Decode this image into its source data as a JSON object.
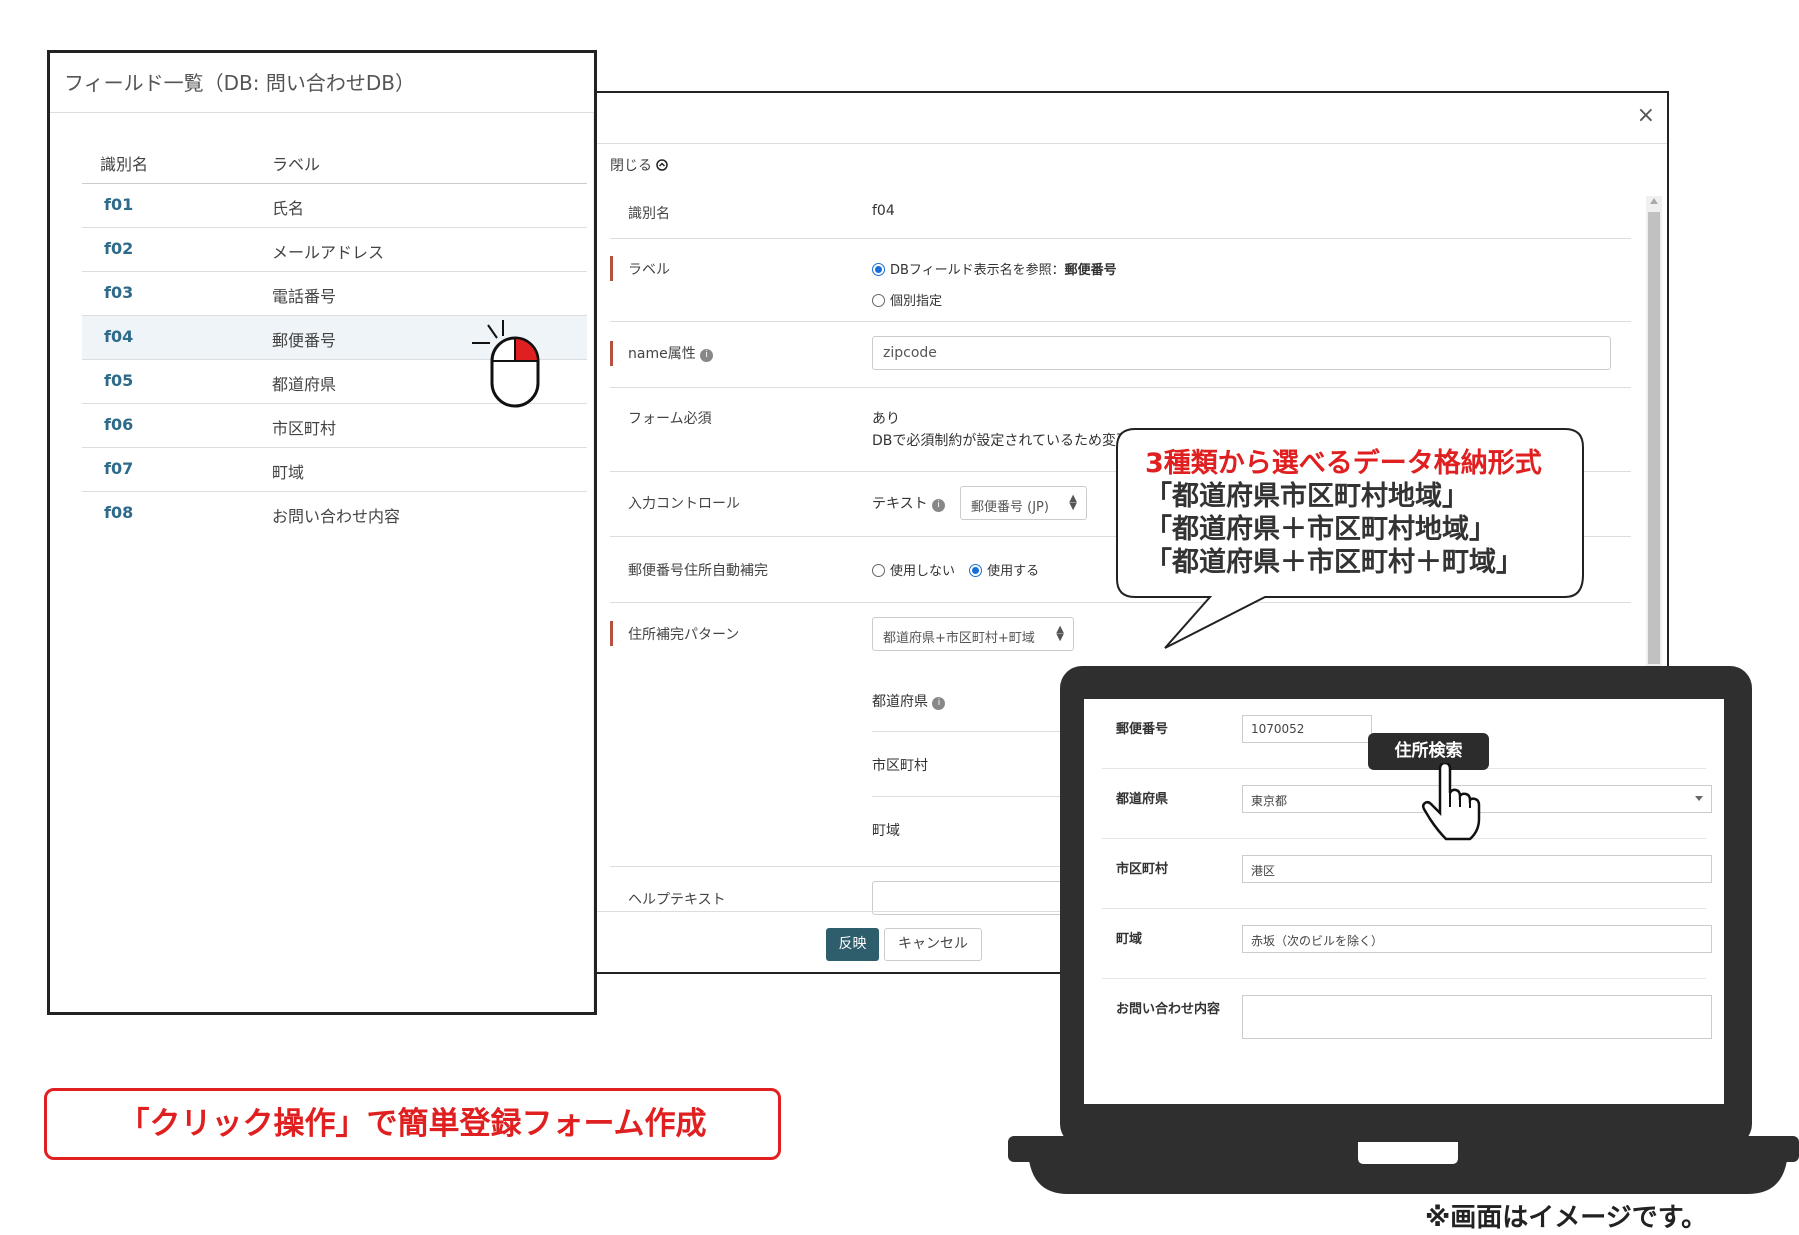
{
  "modal": {
    "close_icon": "×",
    "collapse_label": "閉じる",
    "fields": {
      "identifier": {
        "label": "識別名",
        "value": "f04"
      },
      "label": {
        "label": "ラベル",
        "option_ref": "DBフィールド表示名を参照：",
        "option_ref_value": "郵便番号",
        "option_custom": "個別指定"
      },
      "name_attr": {
        "label": "name属性",
        "value": "zipcode"
      },
      "required": {
        "label": "フォーム必須",
        "value": "あり",
        "note": "DBで必須制約が設定されているため変更"
      },
      "input_control": {
        "label": "入力コントロール",
        "type": "テキスト",
        "select": "郵便番号 (JP)"
      },
      "autocomplete": {
        "label": "郵便番号住所自動補完",
        "off": "使用しない",
        "on": "使用する"
      },
      "pattern": {
        "label": "住所補完パターン",
        "select": "都道府県+市区町村+町域",
        "sub_prefecture": "都道府県",
        "sub_city": "市区町村",
        "sub_town": "町域"
      },
      "help": {
        "label": "ヘルプテキスト"
      }
    },
    "apply_button": "反映",
    "cancel_button": "キャンセル"
  },
  "field_list": {
    "title": "フィールド一覧（DB: 問い合わせDB）",
    "columns": [
      "識別名",
      "ラベル"
    ],
    "rows": [
      {
        "id": "f01",
        "label": "氏名"
      },
      {
        "id": "f02",
        "label": "メールアドレス"
      },
      {
        "id": "f03",
        "label": "電話番号"
      },
      {
        "id": "f04",
        "label": "郵便番号"
      },
      {
        "id": "f05",
        "label": "都道府県"
      },
      {
        "id": "f06",
        "label": "市区町村"
      },
      {
        "id": "f07",
        "label": "町域"
      },
      {
        "id": "f08",
        "label": "お問い合わせ内容"
      }
    ]
  },
  "callout": {
    "title": "3種類から選べるデータ格納形式",
    "line1": "「都道府県市区町村地域」",
    "line2": "「都道府県＋市区町村地域」",
    "line3": "「都道府県＋市区町村＋町域」"
  },
  "preview_form": {
    "zip_label": "郵便番号",
    "zip_value": "1070052",
    "search_button": "住所検索",
    "prefecture_label": "都道府県",
    "prefecture_value": "東京都",
    "city_label": "市区町村",
    "city_value": "港区",
    "town_label": "町域",
    "town_value": "赤坂（次のビルを除く）",
    "inquiry_label": "お問い合わせ内容",
    "inquiry_value": ""
  },
  "banner": "「クリック操作」で簡単登録フォーム作成",
  "note": "※画面はイメージです。",
  "colors": {
    "accent_red": "#e02020",
    "link_teal": "#2e6a8a",
    "apply_button": "#2e5d6b",
    "laptop_body": "#2f2f2f"
  }
}
